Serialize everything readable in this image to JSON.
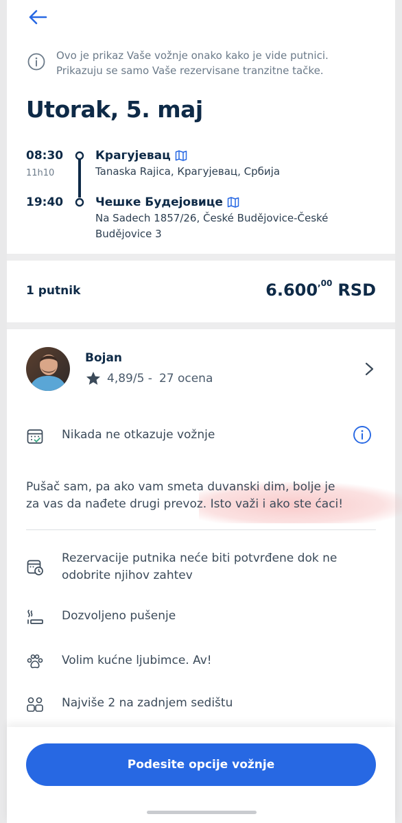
{
  "header": {
    "back_icon": "arrow-left-icon",
    "info_icon": "info-circle-icon",
    "info_line1": "Ovo je prikaz Vaše vožnje onako kako je vide putnici.",
    "info_line2": "Prikazuju se samo Vaše rezervisane tranzitne tačke."
  },
  "trip": {
    "date": "Utorak, 5. maj",
    "departure_time": "08:30",
    "duration": "11h10",
    "departure_city": "Крагујевац",
    "departure_address": "Tanaska Rajica, Крагујевац, Србија",
    "arrival_time": "19:40",
    "arrival_city": "Чешке Будејовице",
    "arrival_address_line1": "Na Sadech 1857/26, České Budějovice-České",
    "arrival_address_line2": "Budějovice 3"
  },
  "price": {
    "passengers": "1 putnik",
    "amount": "6.600",
    "cents": ",00",
    "currency": "RSD"
  },
  "driver": {
    "name": "Bojan",
    "rating": "4,89/5 -",
    "reviews": "27 ocena"
  },
  "features": {
    "never_cancels": "Nikada ne otkazuje vožnje",
    "bio_line1": "Pušač sam, pa ako vam smeta duvanski dim, bolje je",
    "bio_line2": "za vas da nađete drugi prevoz. Isto važi i ako ste ćaci!",
    "approval_line1": "Rezervacije putnika neće biti potvrđene dok ne",
    "approval_line2": "odobrite njihov zahtev",
    "smoking": "Dozvoljeno pušenje",
    "pets": "Volim kućne ljubimce. Av!",
    "back_seat": "Najviše 2 na zadnjem sedištu"
  },
  "cta": {
    "label": "Podesite opcije vožnje"
  },
  "colors": {
    "primary": "#2768e3",
    "text_dark": "#0e2a47",
    "text_muted": "#6b7a89",
    "icon_accent": "#3aa884"
  }
}
